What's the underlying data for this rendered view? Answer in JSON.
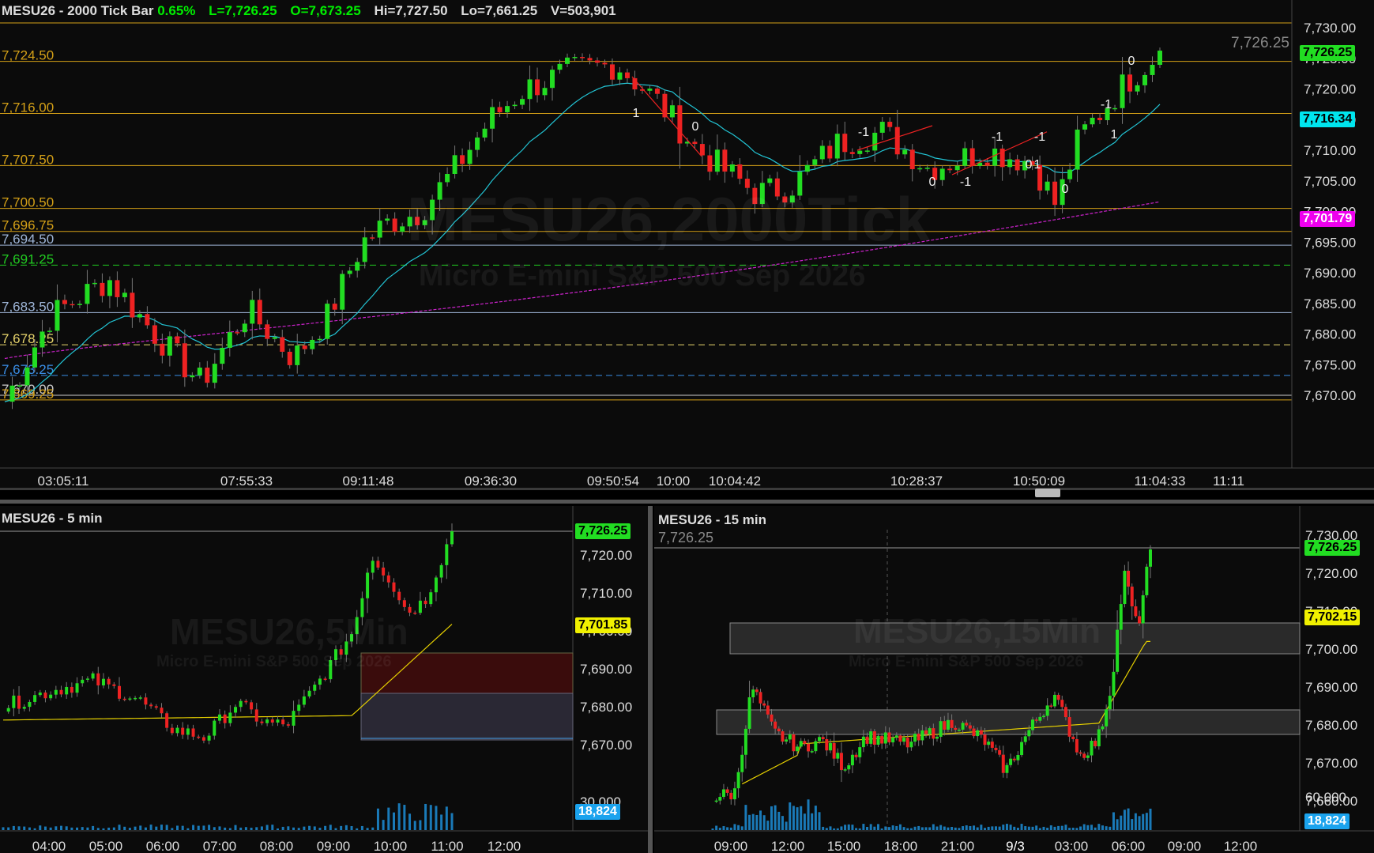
{
  "colors": {
    "up": "#22dd22",
    "down": "#ee2222",
    "bg": "#0b0b0b",
    "axis_text": "#dddddd",
    "green_text": "#00ee00",
    "gold": "#d4a017"
  },
  "main": {
    "symbol": "MESU26",
    "title": " - 2000 Tick Bar",
    "change": "0.65%",
    "last": "L=7,726.25",
    "open": "O=7,673.25",
    "high": "Hi=7,727.50",
    "low": "Lo=7,661.25",
    "volume": "V=503,901",
    "watermark": "MESU26,2000Tick",
    "watermark_sub": "Micro E-mini S&P 500 Sep 2026",
    "last_price_gray": "7,726.25",
    "tag_last": "7,726.25",
    "tag_ema": "7,716.34",
    "tag_vwap": "7,701.79",
    "y_ticks": [
      "7,730.00",
      "7,725.00",
      "7,720.00",
      "7,715.00",
      "7,710.00",
      "7,705.00",
      "7,700.00",
      "7,695.00",
      "7,690.00",
      "7,685.00",
      "7,680.00",
      "7,675.00",
      "7,670.00"
    ],
    "x_ticks": [
      "03:05:11",
      "07:55:33",
      "09:11:48",
      "09:36:30",
      "09:50:54",
      "10:00",
      "10:04:42",
      "10:28:37",
      "10:50:09",
      "11:04:33",
      "11:11"
    ],
    "levels": [
      {
        "label": "7,724.50",
        "price": 7724.5,
        "color": "#d4a017",
        "style": "solid"
      },
      {
        "label": "7,716.00",
        "price": 7716.0,
        "color": "#d4a017",
        "style": "solid"
      },
      {
        "label": "7,707.50",
        "price": 7707.5,
        "color": "#d4a017",
        "style": "solid"
      },
      {
        "label": "7,700.50",
        "price": 7700.5,
        "color": "#d4a017",
        "style": "solid"
      },
      {
        "label": "7,696.75",
        "price": 7696.75,
        "color": "#d4a017",
        "style": "solid"
      },
      {
        "label": "7,694.50",
        "price": 7694.5,
        "color": "#9fb6d8",
        "style": "solid"
      },
      {
        "label": "7,691.25",
        "price": 7691.25,
        "color": "#22cc22",
        "style": "dash"
      },
      {
        "label": "7,683.50",
        "price": 7683.5,
        "color": "#9fb6d8",
        "style": "solid"
      },
      {
        "label": "7,678.25",
        "price": 7678.25,
        "color": "#e6d36b",
        "style": "dash"
      },
      {
        "label": "7,673.25",
        "price": 7673.25,
        "color": "#3a8ee6",
        "style": "dash"
      },
      {
        "label": "7,670.00",
        "price": 7670.0,
        "color": "#cccccc",
        "style": "solid"
      },
      {
        "label": "7,669.25",
        "price": 7669.25,
        "color": "#d4a017",
        "style": "solid"
      }
    ],
    "signals": [
      "1",
      "0",
      "-1",
      "-1",
      "-1",
      "1",
      "0",
      "-1",
      "0",
      "0",
      "-1",
      "1",
      "0"
    ]
  },
  "left": {
    "symbol": "MESU26",
    "title": " - 5 min",
    "watermark": "MESU26,5Min",
    "watermark_sub": "Micro E-mini S&P 500 Sep 2026",
    "tag_last": "7,726.25",
    "tag_vwap": "7,701.85",
    "tag_vol": "18,824",
    "vol_tick": "30,000",
    "y_ticks": [
      "7,720.00",
      "7,710.00",
      "7,700.00",
      "7,690.00",
      "7,680.00",
      "7,670.00"
    ],
    "x_ticks": [
      "04:00",
      "05:00",
      "06:00",
      "07:00",
      "08:00",
      "09:00",
      "10:00",
      "11:00",
      "12:00"
    ]
  },
  "right": {
    "symbol": "MESU26",
    "title": " - 15 min",
    "last_gray": "7,726.25",
    "watermark": "MESU26,15Min",
    "watermark_sub": "Micro E-mini S&P 500 Sep 2026",
    "tag_last": "7,726.25",
    "tag_vwap": "7,702.15",
    "tag_vol": "18,824",
    "vol_tick": "60,000",
    "y_ticks": [
      "7,730.00",
      "7,720.00",
      "7,710.00",
      "7,700.00",
      "7,690.00",
      "7,680.00",
      "7,670.00",
      "7,660.00"
    ],
    "x_ticks": [
      "09:00",
      "12:00",
      "15:00",
      "18:00",
      "21:00",
      "9/3",
      "03:00",
      "06:00",
      "09:00",
      "12:00"
    ]
  }
}
